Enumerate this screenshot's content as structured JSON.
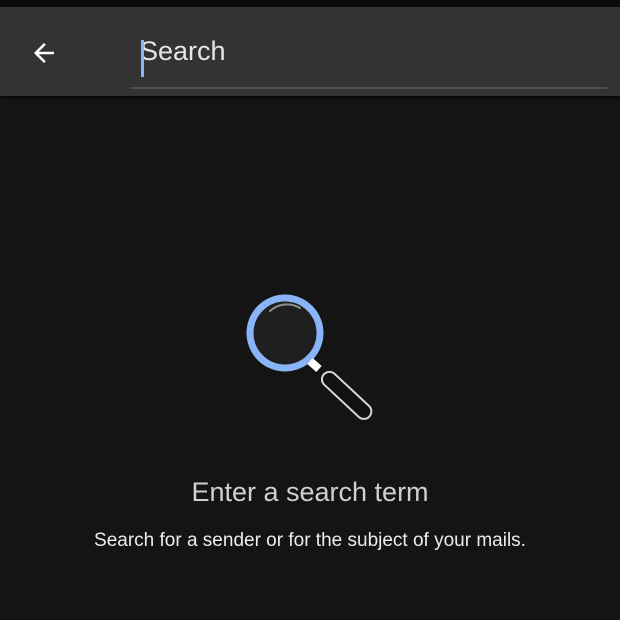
{
  "search": {
    "placeholder": "Search",
    "value": ""
  },
  "toolbar": {
    "back_icon": "arrow-left-icon"
  },
  "empty_state": {
    "icon": "magnifier-icon",
    "title": "Enter a search term",
    "subtitle": "Search for a sender or for the subject of your mails."
  },
  "colors": {
    "background": "#141414",
    "app_bar": "#333333",
    "accent": "#8ab4f8",
    "text_primary": "#ececec",
    "text_secondary": "#d0d0d0"
  }
}
